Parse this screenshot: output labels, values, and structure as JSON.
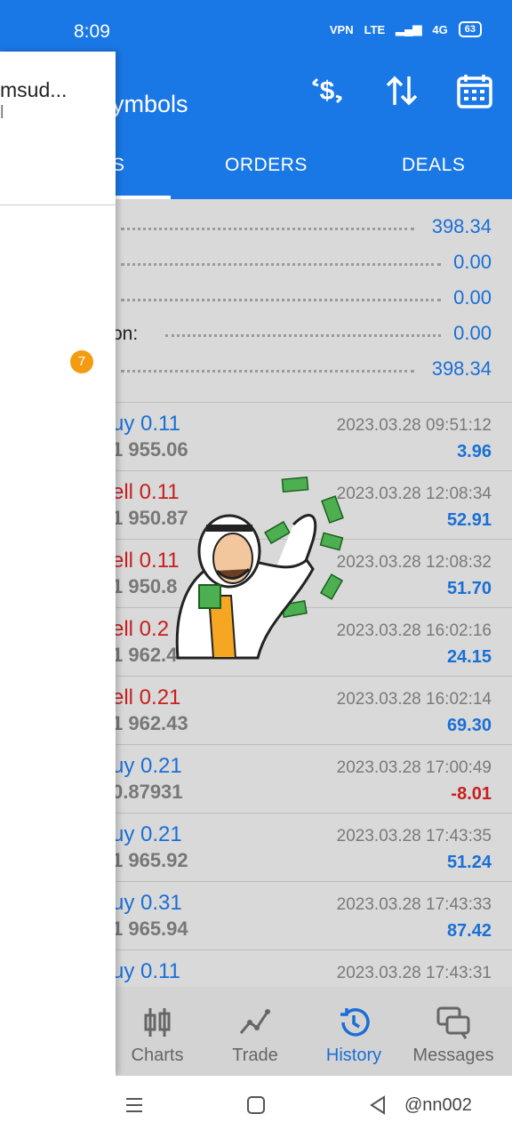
{
  "status_bar": {
    "time": "8:09",
    "network": "4G",
    "battery": "63",
    "bg": "#1a78e6"
  },
  "toolbar": {
    "subtitle": "ymbols",
    "icons": [
      "dollar-swap-icon",
      "sort-arrows-icon",
      "calendar-icon"
    ]
  },
  "tabs": [
    {
      "label": "S"
    },
    {
      "label": "ORDERS"
    },
    {
      "label": "DEALS"
    }
  ],
  "summary": [
    {
      "label": "",
      "value": "398.34"
    },
    {
      "label": "",
      "value": "0.00"
    },
    {
      "label": "",
      "value": "0.00"
    },
    {
      "label": "on:",
      "value": "0.00"
    },
    {
      "label": "",
      "value": "398.34"
    }
  ],
  "deals": [
    {
      "symbol": "uy 0.11",
      "side": "buy",
      "price": "1 955.06",
      "date": "2023.03.28 09:51:12",
      "profit": "3.96"
    },
    {
      "symbol": "ell 0.11",
      "side": "sell",
      "price": "1 950.87",
      "date": "2023.03.28 12:08:34",
      "profit": "52.91"
    },
    {
      "symbol": "ell 0.11",
      "side": "sell",
      "price": "1 950.8",
      "date": "2023.03.28 12:08:32",
      "profit": "51.70"
    },
    {
      "symbol": "ell 0.2",
      "side": "sell",
      "price": "1 962.4",
      "date": "2023.03.28 16:02:16",
      "profit": "24.15"
    },
    {
      "symbol": "ell 0.21",
      "side": "sell",
      "price": "1 962.43",
      "date": "2023.03.28 16:02:14",
      "profit": "69.30"
    },
    {
      "symbol": "uy 0.21",
      "side": "buy",
      "price": "0.87931",
      "date": "2023.03.28 17:00:49",
      "profit": "-8.01"
    },
    {
      "symbol": "uy 0.21",
      "side": "buy",
      "price": "1 965.92",
      "date": "2023.03.28 17:43:35",
      "profit": "51.24"
    },
    {
      "symbol": "uy 0.31",
      "side": "buy",
      "price": "1 965.94",
      "date": "2023.03.28 17:43:33",
      "profit": "87.42"
    },
    {
      "symbol": "uy 0.11",
      "side": "buy",
      "price": "",
      "date": "2023.03.28 17:43:31",
      "profit": ""
    }
  ],
  "bottom_nav": [
    {
      "label": "Charts",
      "icon": "candlestick-icon",
      "active": false
    },
    {
      "label": "Trade",
      "icon": "trend-line-icon",
      "active": false
    },
    {
      "label": "History",
      "icon": "history-clock-icon",
      "active": true
    },
    {
      "label": "Messages",
      "icon": "chat-bubbles-icon",
      "active": false
    }
  ],
  "drawer": {
    "account_name": "msud...",
    "account_sub": "l",
    "badge": "7"
  },
  "system_nav": {
    "watermark": "@nn002"
  },
  "colors": {
    "accent": "#1a78e6",
    "buy": "#1a6fd6",
    "sell": "#c81e1e",
    "badge": "#f39c12"
  }
}
